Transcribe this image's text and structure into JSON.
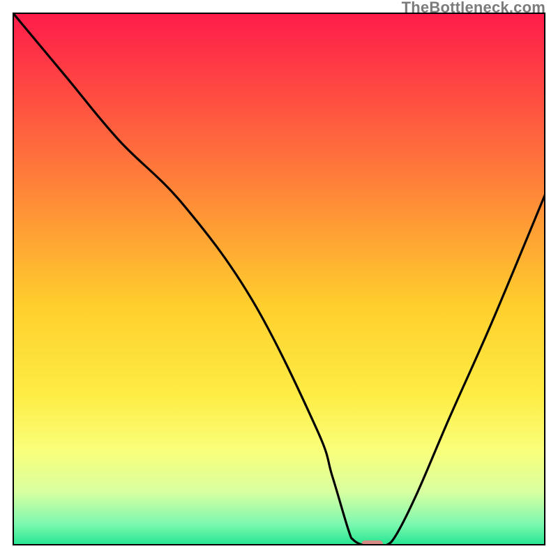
{
  "watermark": "TheBottleneck.com",
  "chart_data": {
    "type": "line",
    "title": "",
    "xlabel": "",
    "ylabel": "",
    "xlim": [
      0,
      100
    ],
    "ylim": [
      0,
      100
    ],
    "grid": false,
    "legend": false,
    "series": [
      {
        "name": "curve",
        "color": "#000000",
        "x": [
          0,
          10,
          20,
          32,
          45,
          57,
          60,
          63,
          64,
          66,
          68,
          70,
          72,
          76,
          82,
          90,
          100
        ],
        "values": [
          100,
          88,
          76,
          64,
          46,
          22,
          13,
          3,
          1,
          0,
          0,
          0,
          2,
          10,
          24,
          42,
          66
        ]
      }
    ],
    "marker": {
      "x": 67.5,
      "y": 0.3,
      "color": "#d58a85",
      "width_pct": 4.0,
      "height_pct": 1.3
    },
    "background_gradient": {
      "type": "vertical",
      "stops": [
        {
          "pos": 0.0,
          "color": "#ff1b4a"
        },
        {
          "pos": 0.3,
          "color": "#ff7a3a"
        },
        {
          "pos": 0.55,
          "color": "#ffcf2d"
        },
        {
          "pos": 0.72,
          "color": "#feed45"
        },
        {
          "pos": 0.82,
          "color": "#faff7a"
        },
        {
          "pos": 0.9,
          "color": "#d8ffa0"
        },
        {
          "pos": 0.96,
          "color": "#7cf8b0"
        },
        {
          "pos": 1.0,
          "color": "#22e590"
        }
      ]
    }
  }
}
